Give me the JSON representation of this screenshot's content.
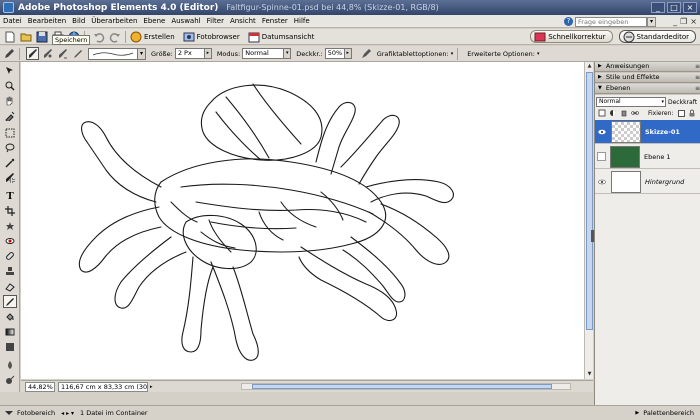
{
  "titlebar": {
    "app_name": "Adobe Photoshop Elements 4.0 (Editor)",
    "document": "Faltfigur-Spinne-01.psd bei 44,8% (Skizze-01, RGB/8)"
  },
  "menu": {
    "items": [
      "Datei",
      "Bearbeiten",
      "Bild",
      "Überarbeiten",
      "Ebene",
      "Auswahl",
      "Filter",
      "Ansicht",
      "Fenster",
      "Hilfe"
    ],
    "help_placeholder": "Frage eingeben"
  },
  "shortcuts": {
    "tooltip": "Speichern",
    "create_label": "Erstellen",
    "browser_label": "Fotobrowser",
    "date_label": "Datumsansicht",
    "quickfix_label": "Schnellkorrektur",
    "standard_label": "Standardeditor"
  },
  "options": {
    "size_label": "Größe:",
    "size_value": "2 Px",
    "mode_label": "Modus:",
    "mode_value": "Normal",
    "opacity_label": "Deckkr.:",
    "opacity_value": "50%",
    "tablet_label": "Grafiktablettoptionen:",
    "advanced_label": "Erweiterte Optionen:"
  },
  "status": {
    "zoom": "44,82%",
    "doc_size": "116,67 cm x 83,33 cm (30 ppcm)"
  },
  "bin": {
    "photo_bin_label": "Fotobereich",
    "status_text": "1 Datei im Container",
    "palette_label": "Palettenbereich"
  },
  "palettes": {
    "headers": [
      "Anweisungen",
      "Stile und Effekte",
      "Ebenen"
    ],
    "blend_mode": "Normal",
    "opacity_label": "Deckkraft",
    "lock_label": "Fixieren:",
    "layers": [
      {
        "name": "Skizze-01"
      },
      {
        "name": "Ebene 1"
      },
      {
        "name": "Hintergrund"
      }
    ]
  },
  "colors": {
    "selected_layer": "#3169c6",
    "titlebar": "#34456b",
    "canvas": "#ffffff"
  }
}
